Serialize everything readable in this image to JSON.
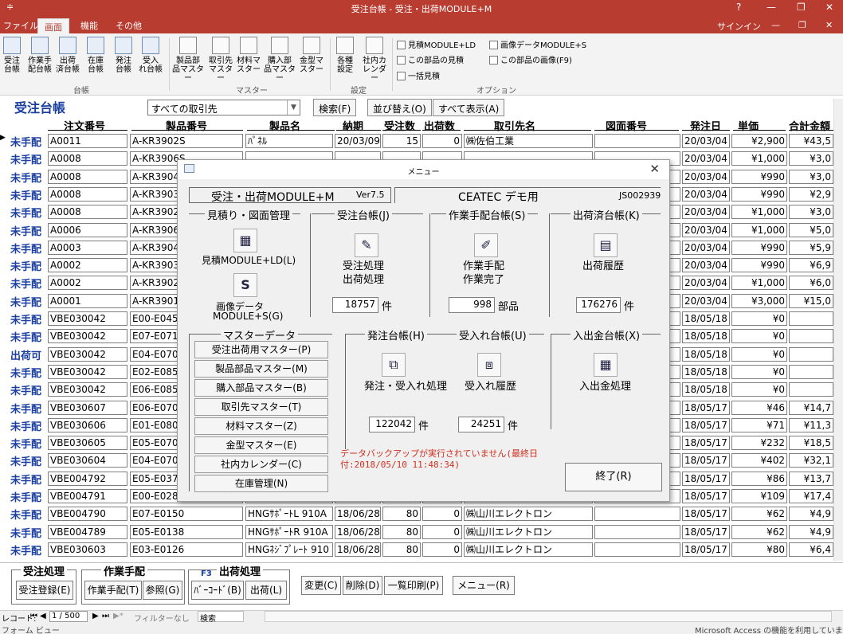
{
  "app": {
    "title": "受注台帳 - 受注・出荷MODULE+M",
    "quick": "≑",
    "help": "?",
    "min": "—",
    "restore": "❐",
    "close": "✕",
    "signin": "サインイン",
    "min2": "—",
    "restore2": "❐",
    "close2": "✕"
  },
  "tabs": [
    "ファイル",
    "画面",
    "機能",
    "その他"
  ],
  "ribbon": {
    "groups": {
      "daicho": "台帳",
      "master": "マスター",
      "settings": "設定",
      "options": "オプション"
    },
    "buttons": [
      {
        "l1": "受注",
        "l2": "台帳",
        "icon": "ledger-icon"
      },
      {
        "l1": "作業手",
        "l2": "配台帳",
        "icon": "worksheet-icon"
      },
      {
        "l1": "出荷",
        "l2": "済台帳",
        "icon": "shipping-icon"
      },
      {
        "l1": "在庫",
        "l2": "台帳",
        "icon": "inventory-icon"
      },
      {
        "l1": "発注",
        "l2": "台帳",
        "icon": "order-icon"
      },
      {
        "l1": "受入",
        "l2": "れ台帳",
        "icon": "receipt-icon"
      },
      {
        "l1": "製品部",
        "l2": "品マスター",
        "icon": "parts-icon"
      },
      {
        "l1": "取引先",
        "l2": "マスター",
        "icon": "client-icon"
      },
      {
        "l1": "材料マ",
        "l2": "スター",
        "icon": "material-icon"
      },
      {
        "l1": "購入部",
        "l2": "品マスター",
        "icon": "purchase-icon"
      },
      {
        "l1": "金型マ",
        "l2": "スター",
        "icon": "mold-icon"
      },
      {
        "l1": "各種",
        "l2": "設定",
        "icon": "settings-icon"
      },
      {
        "l1": "社内カ",
        "l2": "レンダー",
        "icon": "calendar-icon"
      }
    ],
    "small": [
      "見積MODULE+LD",
      "この部品の見積",
      "一括見積",
      "画像データMODULE+S",
      "この部品の画像(F9)"
    ]
  },
  "form": {
    "title": "受注台帳",
    "filter": "すべての取引先",
    "search": "検索(F)",
    "sort": "並び替え(O)",
    "showall": "すべて表示(A)"
  },
  "columns": [
    "注文番号",
    "製品番号",
    "製品名",
    "納期",
    "受注数",
    "出荷数",
    "取引先名",
    "図面番号",
    "発注日",
    "単価",
    "合計金額"
  ],
  "rows": [
    [
      "未手配",
      "A0011",
      "A-KR3902S",
      "ﾊﾟﾈﾙ",
      "20/03/09",
      "15",
      "0",
      "㈱佐伯工業",
      "",
      "20/03/04",
      "¥2,900",
      "¥43,5"
    ],
    [
      "未手配",
      "A0008",
      "A-KR3906S",
      "",
      "",
      "",
      "",
      "",
      "",
      "20/03/04",
      "¥1,000",
      "¥3,0"
    ],
    [
      "未手配",
      "A0008",
      "A-KR3904S",
      "",
      "",
      "",
      "",
      "",
      "",
      "20/03/04",
      "¥990",
      "¥3,0"
    ],
    [
      "未手配",
      "A0008",
      "A-KR3903S",
      "",
      "",
      "",
      "",
      "",
      "",
      "20/03/04",
      "¥990",
      "¥2,9"
    ],
    [
      "未手配",
      "A0008",
      "A-KR3902S",
      "",
      "",
      "",
      "",
      "",
      "",
      "20/03/04",
      "¥1,000",
      "¥3,0"
    ],
    [
      "未手配",
      "A0006",
      "A-KR3906S",
      "",
      "",
      "",
      "",
      "",
      "",
      "20/03/04",
      "¥1,000",
      "¥5,0"
    ],
    [
      "未手配",
      "A0003",
      "A-KR3904S",
      "",
      "",
      "",
      "",
      "",
      "",
      "20/03/04",
      "¥990",
      "¥5,9"
    ],
    [
      "未手配",
      "A0002",
      "A-KR3903S",
      "",
      "",
      "",
      "",
      "",
      "",
      "20/03/04",
      "¥990",
      "¥6,9"
    ],
    [
      "未手配",
      "A0002",
      "A-KR3902S",
      "",
      "",
      "",
      "",
      "",
      "",
      "20/03/04",
      "¥1,000",
      "¥6,0"
    ],
    [
      "未手配",
      "A0001",
      "A-KR3901S",
      "",
      "",
      "",
      "",
      "",
      "",
      "20/03/04",
      "¥3,000",
      "¥15,0"
    ],
    [
      "未手配",
      "VBE030042",
      "E00-E0453",
      "",
      "",
      "",
      "",
      "",
      "",
      "18/05/18",
      "¥0",
      ""
    ],
    [
      "未手配",
      "VBE030042",
      "E07-E0710",
      "",
      "",
      "",
      "",
      "",
      "",
      "18/05/18",
      "¥0",
      ""
    ],
    [
      "出荷可",
      "VBE030042",
      "E04-E0707",
      "",
      "",
      "",
      "",
      "",
      "",
      "18/05/18",
      "¥0",
      ""
    ],
    [
      "未手配",
      "VBE030042",
      "E02-E0855",
      "",
      "",
      "",
      "",
      "",
      "",
      "18/05/18",
      "¥0",
      ""
    ],
    [
      "未手配",
      "VBE030042",
      "E06-E0859",
      "",
      "",
      "",
      "",
      "",
      "",
      "18/05/18",
      "¥0",
      ""
    ],
    [
      "未手配",
      "VBE030607",
      "E06-E0709",
      "",
      "",
      "",
      "",
      "",
      "",
      "18/05/17",
      "¥46",
      "¥14,7"
    ],
    [
      "未手配",
      "VBE030606",
      "E01-E0804",
      "",
      "",
      "",
      "",
      "",
      "",
      "18/05/17",
      "¥71",
      "¥11,3"
    ],
    [
      "未手配",
      "VBE030605",
      "E05-E0708",
      "",
      "",
      "",
      "",
      "",
      "",
      "18/05/17",
      "¥232",
      "¥18,5"
    ],
    [
      "未手配",
      "VBE030604",
      "E04-E0707",
      "",
      "",
      "",
      "",
      "",
      "",
      "18/05/17",
      "¥402",
      "¥32,1"
    ],
    [
      "未手配",
      "VBE004792",
      "E05-E0378",
      "",
      "",
      "",
      "",
      "",
      "",
      "18/05/17",
      "¥86",
      "¥13,7"
    ],
    [
      "未手配",
      "VBE004791",
      "E00-E0283",
      "",
      "",
      "",
      "",
      "",
      "",
      "18/05/17",
      "¥109",
      "¥17,4"
    ],
    [
      "未手配",
      "VBE004790",
      "E07-E0150",
      "HNGｻﾎﾟｰﾄL 910A",
      "18/06/28",
      "80",
      "0",
      "㈱山川エレクトロン",
      "",
      "18/05/17",
      "¥62",
      "¥4,9"
    ],
    [
      "未手配",
      "VBE004789",
      "E05-E0138",
      "HNGｻﾎﾟｰﾄR 910A",
      "18/06/28",
      "80",
      "0",
      "㈱山川エレクトロン",
      "",
      "18/05/17",
      "¥62",
      "¥4,9"
    ],
    [
      "未手配",
      "VBE030603",
      "E03-E0126",
      "HNGﾈｼﾞﾌﾟﾚｰﾄ 910",
      "18/06/28",
      "80",
      "0",
      "㈱山川エレクトロン",
      "",
      "18/05/17",
      "¥80",
      "¥6,4"
    ]
  ],
  "bottom": {
    "g1": "受注処理",
    "g2": "作業手配",
    "g3": "出荷処理",
    "f3": "F3",
    "b1": "受注登録(E)",
    "b2": "作業手配(T)",
    "b3": "参照(G)",
    "b4": "ﾊﾞｰｺｰﾄﾞ(B)",
    "b5": "出荷(L)",
    "b6": "変更(C)",
    "b7": "削除(D)",
    "b8": "一覧印刷(P)",
    "b9": "メニュー(R)"
  },
  "status": {
    "record": "レコード:",
    "first": "⏮",
    "prev": "◀",
    "pos": "1 / 500",
    "next": "▶",
    "last": "⏭",
    "new": "▶*",
    "nofilter": "フィルターなし",
    "search": "検索",
    "view": "フォーム ビュー",
    "access": "Microsoft Access の機能を利用しています"
  },
  "dialog": {
    "title": "メニュー",
    "product": "受注・出荷MODULE+M",
    "ver": "Ver7.5",
    "company": "CEATEC デモ用",
    "code": "JS002939",
    "s1": "見積り・図面管理",
    "s2": "受注台帳(J)",
    "s3": "作業手配台帳(S)",
    "s4": "出荷済台帳(K)",
    "quote": "見積MODULE+LD(L)",
    "image1": "画像データ",
    "image2": "MODULE+S(G)",
    "order1": "受注処理",
    "order2": "出荷処理",
    "order_count": "18757",
    "unit_ken": "件",
    "work1": "作業手配",
    "work2": "作業完了",
    "work_count": "998",
    "unit_buhin": "部品",
    "ship": "出荷履歴",
    "ship_count": "176276",
    "master": "マスターデータ",
    "masters": [
      "受注出荷用マスター(P)",
      "製品部品マスター(M)",
      "購入部品マスター(B)",
      "取引先マスター(T)",
      "材料マスター(Z)",
      "金型マスター(E)",
      "社内カレンダー(C)",
      "在庫管理(N)"
    ],
    "s5": "発注台帳(H)",
    "s6": "受入れ台帳(U)",
    "s7": "入出金台帳(X)",
    "po": "発注・受入れ処理",
    "po_count": "122042",
    "rc": "受入れ履歴",
    "rc_count": "24251",
    "pay": "入出金処理",
    "warn": "データバックアップが実行されていません(最終日付:2018/05/10 11:48:34)",
    "exit": "終了(R)",
    "warn_color": "#d03020"
  }
}
